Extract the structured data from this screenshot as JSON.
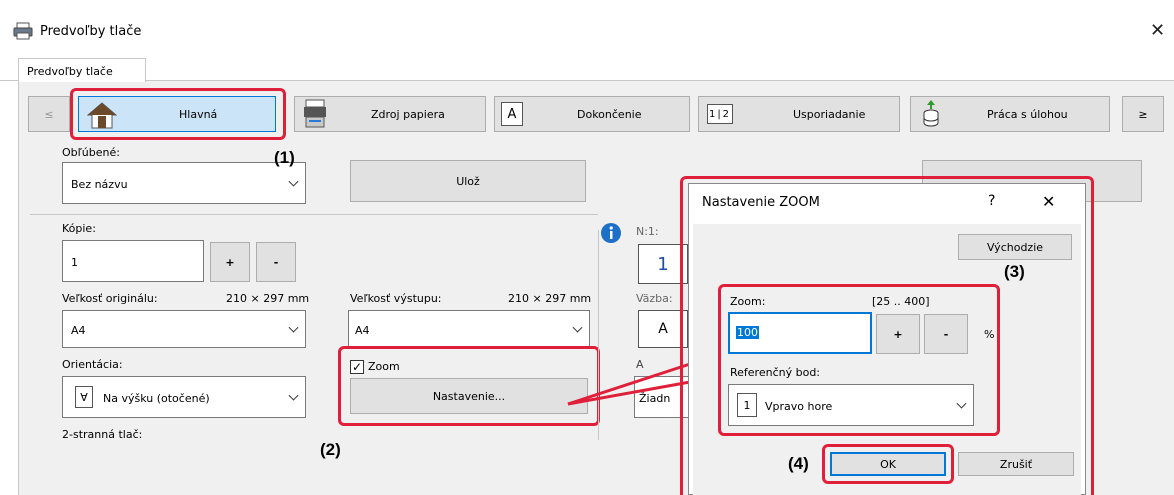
{
  "window": {
    "title": "Predvoľby tlače"
  },
  "tab": {
    "label": "Predvoľby tlače"
  },
  "nav": {
    "prev": "≤",
    "next": "≥",
    "items": [
      {
        "label": "Hlavná",
        "icon": "home-icon"
      },
      {
        "label": "Zdroj papiera",
        "icon": "printer-tray-icon"
      },
      {
        "label": "Dokončenie",
        "icon": "finishing-icon"
      },
      {
        "label": "Usporiadanie",
        "icon": "layout-icon"
      },
      {
        "label": "Práca s úlohou",
        "icon": "job-icon"
      }
    ]
  },
  "favorites": {
    "label": "Obľúbené:",
    "value": "Bez názvu",
    "save_label": "Ulož"
  },
  "copies": {
    "label": "Kópie:",
    "value": "1",
    "plus": "+",
    "minus": "-"
  },
  "original_size": {
    "label": "Veľkosť originálu:",
    "dims": "210 × 297 mm",
    "value": "A4"
  },
  "output_size": {
    "label": "Veľkosť výstupu:",
    "dims": "210 × 297 mm",
    "value": "A4"
  },
  "orientation": {
    "label": "Orientácia:",
    "value": "Na výšku (otočené)"
  },
  "zoom_checkbox": {
    "label": "Zoom",
    "checked": true
  },
  "settings_button": "Nastavenie...",
  "duplex_label": "2-stranná tlač:",
  "right_col": {
    "n1_label": "N:1:",
    "n1_value": "1",
    "binding_label": "Väzba:",
    "binding_value": "A",
    "partial_a": "A",
    "partial_none": "Žiadn"
  },
  "dialog": {
    "title": "Nastavenie ZOOM",
    "help": "?",
    "close": "X",
    "default_button": "Východzie",
    "zoom_label": "Zoom:",
    "zoom_range": "[25 .. 400]",
    "zoom_value": "100",
    "zoom_unit": "%",
    "plus": "+",
    "minus": "-",
    "ref_label": "Referenčný bod:",
    "ref_value": "Vpravo hore",
    "ok": "OK",
    "cancel": "Zrušiť"
  },
  "callouts": [
    "(1)",
    "(2)",
    "(3)",
    "(4)"
  ],
  "colors": {
    "highlight": "#e0203a",
    "selected_tab": "#cce4f7",
    "selected_border": "#0078d7"
  }
}
